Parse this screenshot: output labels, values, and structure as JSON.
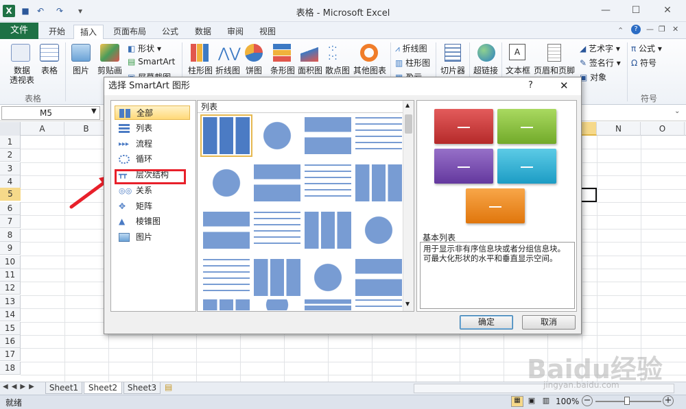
{
  "window": {
    "title": "表格 - Microsoft Excel"
  },
  "tabs": [
    "文件",
    "开始",
    "插入",
    "页面布局",
    "公式",
    "数据",
    "审阅",
    "视图"
  ],
  "ribbon": {
    "pivot_label1": "数据",
    "pivot_label2": "透视表",
    "table_label": "表格",
    "tables_group": "表格",
    "picture_label": "图片",
    "clipart_label": "剪贴画",
    "shapes_label": "形状",
    "smartart_label": "SmartArt",
    "screenshot_label": "屏幕截图",
    "column_chart": "柱形图",
    "line_chart": "折线图",
    "pie_chart": "饼图",
    "bar_chart": "条形图",
    "area_chart": "面积图",
    "scatter_chart": "散点图",
    "other_chart": "其他图表",
    "spark_line": "折线图",
    "spark_column": "柱形图",
    "spark_winloss": "盈亏",
    "slicer": "切片器",
    "hyperlink": "超链接",
    "textbox": "文本框",
    "header_footer": "页眉和页脚",
    "wordart": "艺术字",
    "signature": "签名行",
    "object": "对象",
    "equation": "公式",
    "symbol": "符号",
    "symbols_group": "符号"
  },
  "formula_bar": {
    "name_box": "M5"
  },
  "columns": [
    "A",
    "B",
    "N",
    "O"
  ],
  "rows": [
    "1",
    "2",
    "3",
    "4",
    "5",
    "6",
    "7",
    "8",
    "9",
    "10",
    "11",
    "12",
    "13",
    "14",
    "15",
    "16",
    "17",
    "18"
  ],
  "sheets": [
    "Sheet1",
    "Sheet2",
    "Sheet3"
  ],
  "status": {
    "ready": "就绪",
    "zoom": "100%"
  },
  "dialog": {
    "title": "选择 SmartArt 图形",
    "help": "?",
    "close": "✕",
    "categories": [
      "全部",
      "列表",
      "流程",
      "循环",
      "层次结构",
      "关系",
      "矩阵",
      "棱锥图",
      "图片"
    ],
    "center_header": "列表",
    "preview_name": "基本列表",
    "preview_desc": "用于显示非有序信息块或者分组信息块。可最大化形状的水平和垂直显示空间。",
    "ok": "确定",
    "cancel": "取消"
  },
  "colors": {
    "excel_green": "#1e7145",
    "highlight": "#e8202a",
    "box_red": "#d23a3a",
    "box_green": "#8cc63e",
    "box_purple": "#7b4fb4",
    "box_cyan": "#2fb6d8",
    "box_orange": "#f28c1e"
  },
  "watermark": {
    "brand": "Baidu经验",
    "url": "jingyan.baidu.com"
  }
}
